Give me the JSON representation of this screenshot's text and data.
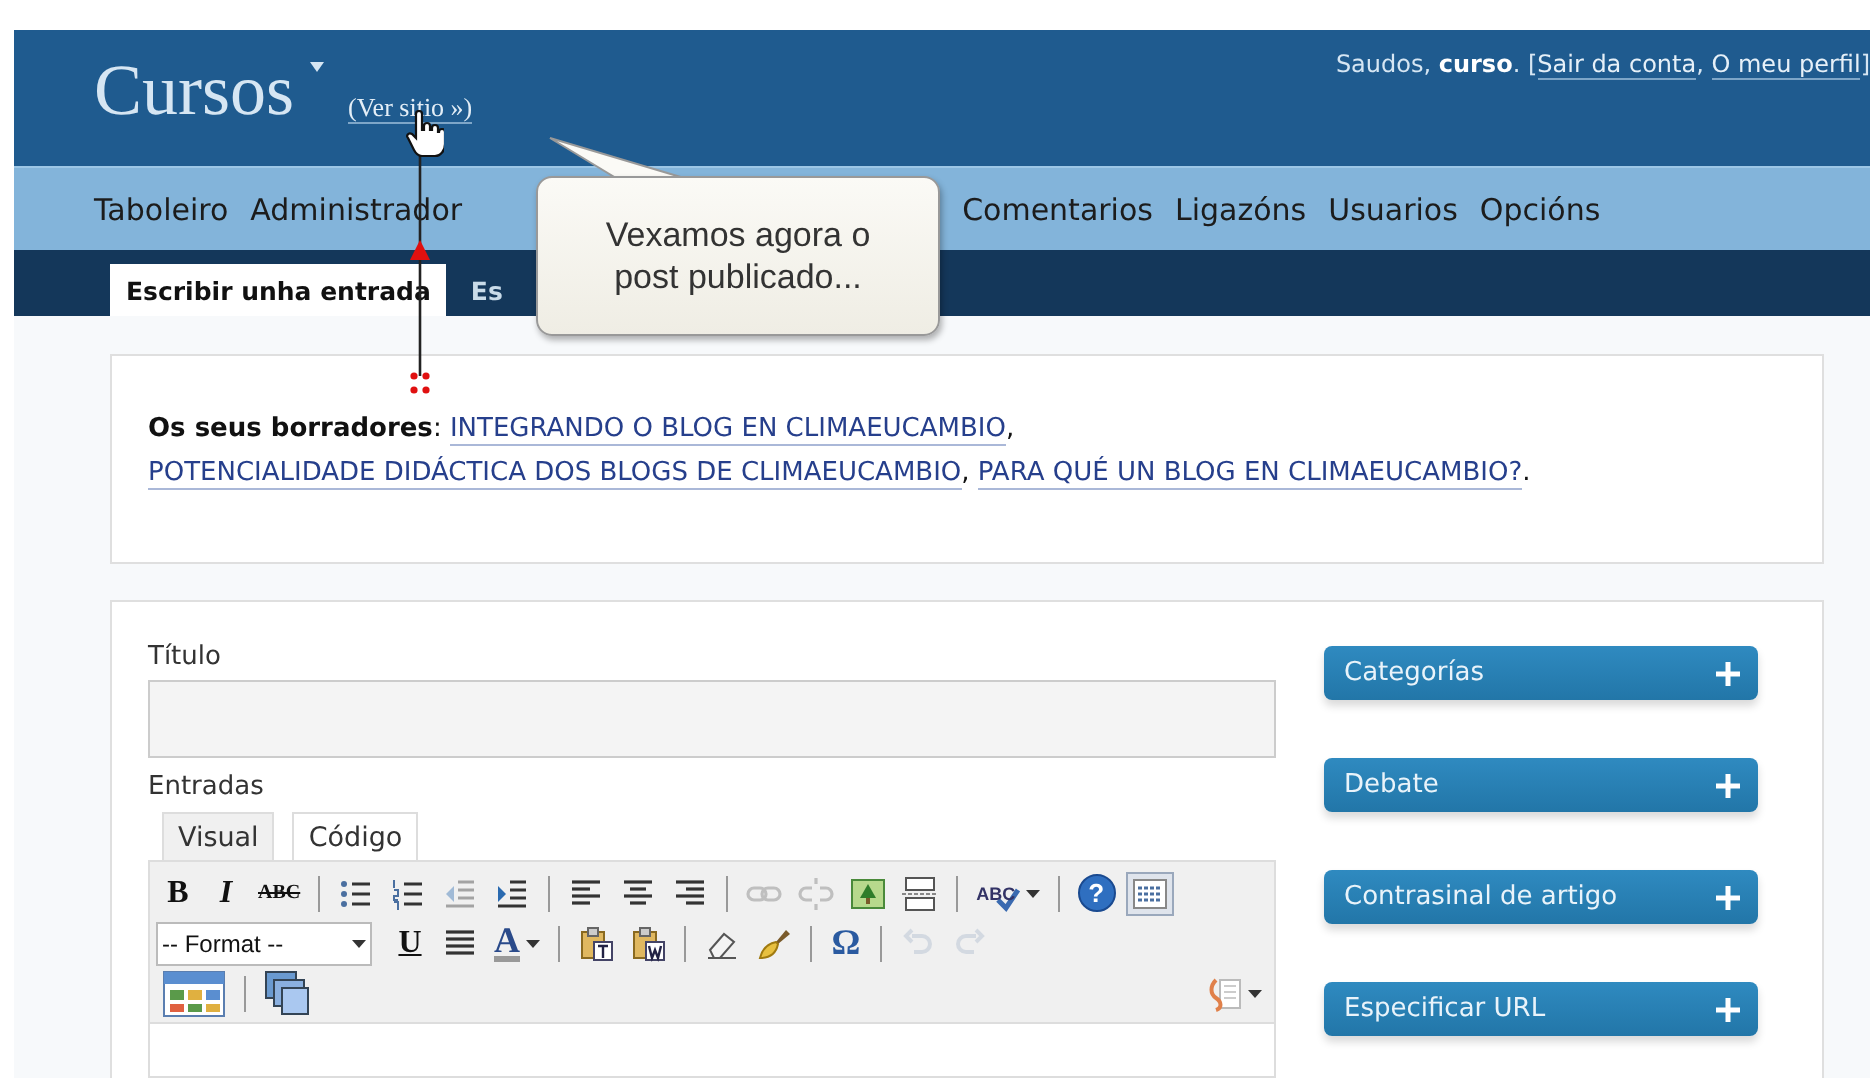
{
  "header": {
    "site_title": "Cursos",
    "view_site": "(Ver sitio »)",
    "greeting": {
      "prefix": "Saudos, **curso**. [",
      "links": [
        "Sair da conta",
        "O meu perfil"
      ],
      "separator": ", ",
      "suffix": "]"
    }
  },
  "menu": {
    "groups": [
      {
        "items": [
          "Taboleiro",
          "Administrador"
        ]
      },
      {
        "items": [
          "Comentarios",
          "Ligazóns",
          "Usuarios",
          "Opcións"
        ]
      }
    ]
  },
  "subtabs": [
    {
      "label": "Escribir unha entrada",
      "selected": true
    },
    {
      "label": "Es",
      "selected": false
    }
  ],
  "callout": {
    "text": "Vexamos agora o post publicado..."
  },
  "drafts": {
    "prefix": "**Os seus borradores**: ",
    "links": [
      "INTEGRANDO O BLOG EN CLIMAEUCAMBIO",
      "POTENCIALIDADE DIDÁCTICA DOS BLOGS DE CLIMAEUCAMBIO",
      "PARA QUÉ UN BLOG EN CLIMAEUCAMBIO?"
    ],
    "separator": ", ",
    "suffix": "."
  },
  "editor": {
    "title_label": "Título",
    "content_label": "Entradas",
    "tabs": [
      {
        "label": "Visual",
        "selected": true
      },
      {
        "label": "Código",
        "selected": false
      }
    ],
    "toolbar": [
      {
        "items": [
          {
            "kind": "bold",
            "label": "B",
            "disabled": false,
            "pressed": false
          },
          {
            "kind": "italic",
            "label": "I",
            "disabled": false,
            "pressed": false
          },
          {
            "kind": "strike",
            "label": "ABC",
            "disabled": false,
            "pressed": false
          },
          {
            "kind": "separator"
          },
          {
            "kind": "bullist",
            "disabled": false,
            "pressed": false
          },
          {
            "kind": "numlist",
            "disabled": false,
            "pressed": false
          },
          {
            "kind": "outdent",
            "disabled": true,
            "pressed": false
          },
          {
            "kind": "indent",
            "disabled": false,
            "pressed": false
          },
          {
            "kind": "separator"
          },
          {
            "kind": "alignleft",
            "disabled": false,
            "pressed": false
          },
          {
            "kind": "aligncenter",
            "disabled": false,
            "pressed": false
          },
          {
            "kind": "alignright",
            "disabled": false,
            "pressed": false
          },
          {
            "kind": "separator"
          },
          {
            "kind": "link",
            "disabled": true,
            "pressed": false
          },
          {
            "kind": "unlink",
            "disabled": true,
            "pressed": false
          },
          {
            "kind": "image",
            "disabled": false,
            "pressed": false
          },
          {
            "kind": "pagebreak",
            "disabled": false,
            "pressed": false
          },
          {
            "kind": "separator"
          },
          {
            "kind": "spellcheck",
            "label": "ABC",
            "disabled": false,
            "pressed": false
          },
          {
            "kind": "separator"
          },
          {
            "kind": "help",
            "label": "?",
            "disabled": false,
            "pressed": false
          },
          {
            "kind": "kitchensink",
            "disabled": false,
            "pressed": true
          }
        ]
      },
      {
        "items": [
          {
            "kind": "select",
            "label": "-- Format --",
            "disabled": false,
            "pressed": false
          },
          {
            "kind": "underline",
            "label": "U",
            "disabled": false,
            "pressed": false
          },
          {
            "kind": "justify",
            "disabled": false,
            "pressed": false
          },
          {
            "kind": "textcolor",
            "label": "A",
            "disabled": false,
            "pressed": false
          },
          {
            "kind": "separator"
          },
          {
            "kind": "pastetext",
            "disabled": false,
            "pressed": false
          },
          {
            "kind": "pasteword",
            "disabled": false,
            "pressed": false
          },
          {
            "kind": "separator"
          },
          {
            "kind": "eraser",
            "disabled": false,
            "pressed": false
          },
          {
            "kind": "brush",
            "disabled": false,
            "pressed": false
          },
          {
            "kind": "separator"
          },
          {
            "kind": "charmap",
            "label": "Ω",
            "disabled": false,
            "pressed": false
          },
          {
            "kind": "separator"
          },
          {
            "kind": "undo",
            "disabled": true,
            "pressed": false
          },
          {
            "kind": "redo",
            "disabled": true,
            "pressed": false
          }
        ]
      },
      {
        "items": [
          {
            "kind": "table",
            "disabled": false,
            "pressed": false
          },
          {
            "kind": "separator"
          },
          {
            "kind": "layers",
            "disabled": false,
            "pressed": false
          },
          {
            "kind": "media",
            "disabled": false,
            "pressed": false
          }
        ]
      }
    ]
  },
  "sidebar": [
    {
      "label": "Categorías",
      "expanded": false
    },
    {
      "label": "Debate",
      "expanded": false
    },
    {
      "label": "Contrasinal de artigo",
      "expanded": false
    },
    {
      "label": "Especificar URL",
      "expanded": false
    }
  ]
}
